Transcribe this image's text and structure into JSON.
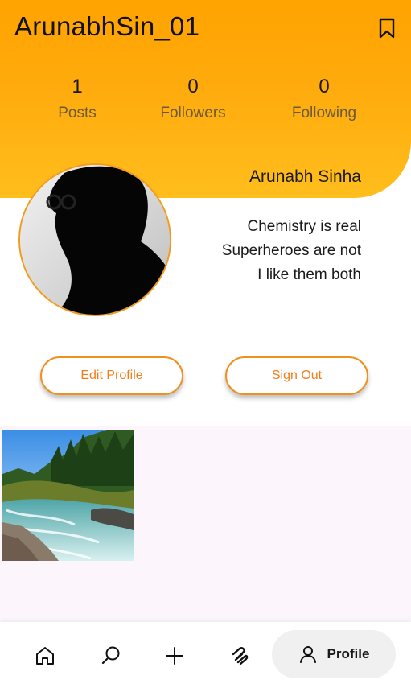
{
  "header": {
    "username": "ArunabhSin_01",
    "bookmark_icon": "bookmark-icon",
    "gradient": [
      "#ffa300",
      "#ffbe1c"
    ]
  },
  "stats": [
    {
      "value": "1",
      "label": "Posts"
    },
    {
      "value": "0",
      "label": "Followers"
    },
    {
      "value": "0",
      "label": "Following"
    }
  ],
  "profile": {
    "display_name": "Arunabh Sinha",
    "bio_lines": [
      "Chemistry is real",
      "Superheroes are not",
      "I like them both"
    ]
  },
  "actions": {
    "edit_label": "Edit Profile",
    "signout_label": "Sign Out",
    "accent": "#f0901e"
  },
  "posts": [
    {
      "image": "river-forest-landscape"
    }
  ],
  "bottom_nav": {
    "items": [
      {
        "icon": "home-icon"
      },
      {
        "icon": "search-icon"
      },
      {
        "icon": "plus-icon"
      },
      {
        "icon": "feed-icon"
      },
      {
        "icon": "profile-icon",
        "label": "Profile",
        "active": true
      }
    ]
  }
}
